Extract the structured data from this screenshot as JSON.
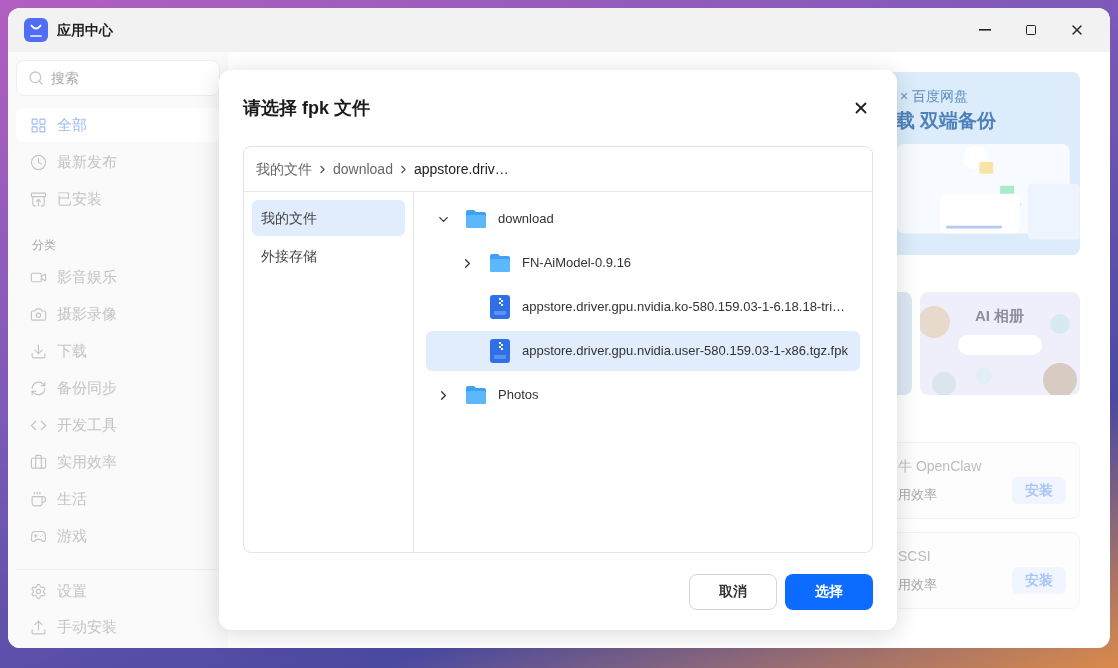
{
  "window": {
    "title": "应用中心"
  },
  "sidebar": {
    "search": {
      "placeholder": "搜索"
    },
    "items": [
      {
        "label": "全部",
        "selected": true
      },
      {
        "label": "最新发布",
        "selected": false
      },
      {
        "label": "已安装",
        "selected": false
      }
    ],
    "section_label": "分类",
    "categories": [
      {
        "label": "影音娱乐",
        "selected": false
      },
      {
        "label": "摄影录像",
        "selected": false
      },
      {
        "label": "下载",
        "selected": false
      },
      {
        "label": "备份同步",
        "selected": false
      },
      {
        "label": "开发工具",
        "selected": false
      },
      {
        "label": "实用效率",
        "selected": false
      },
      {
        "label": "生活",
        "selected": false
      },
      {
        "label": "游戏",
        "selected": false
      }
    ],
    "footer": [
      {
        "label": "设置"
      },
      {
        "label": "手动安装"
      }
    ]
  },
  "banner": {
    "subtitle": "× 百度网盘",
    "title": "载 双端备份"
  },
  "album_card": {
    "title": "AI 相册"
  },
  "apps": [
    {
      "name": "牛 OpenClaw",
      "category": "用效率",
      "button": "安装"
    },
    {
      "name": "SCSI",
      "category": "用效率",
      "button": "安装"
    }
  ],
  "dialog": {
    "title": "请选择 fpk 文件",
    "breadcrumb": [
      "我的文件",
      "download",
      "appstore.driv…"
    ],
    "locations": [
      {
        "label": "我的文件",
        "selected": true
      },
      {
        "label": "外接存储",
        "selected": false
      }
    ],
    "tree": [
      {
        "kind": "folder",
        "name": "download",
        "expanded": true,
        "selected": false,
        "children": [
          {
            "kind": "folder",
            "name": "FN-AiModel-0.9.16",
            "expanded": false,
            "selected": false
          },
          {
            "kind": "file",
            "name": "appstore.driver.gpu.nvidia.ko-580.159.03-1-6.18.18-tri…",
            "selected": false
          },
          {
            "kind": "file",
            "name": "appstore.driver.gpu.nvidia.user-580.159.03-1-x86.tgz.fpk",
            "selected": true
          }
        ]
      },
      {
        "kind": "folder",
        "name": "Photos",
        "expanded": false,
        "selected": false
      }
    ],
    "buttons": [
      {
        "label": "取消",
        "kind": "secondary"
      },
      {
        "label": "选择",
        "kind": "primary"
      }
    ]
  }
}
